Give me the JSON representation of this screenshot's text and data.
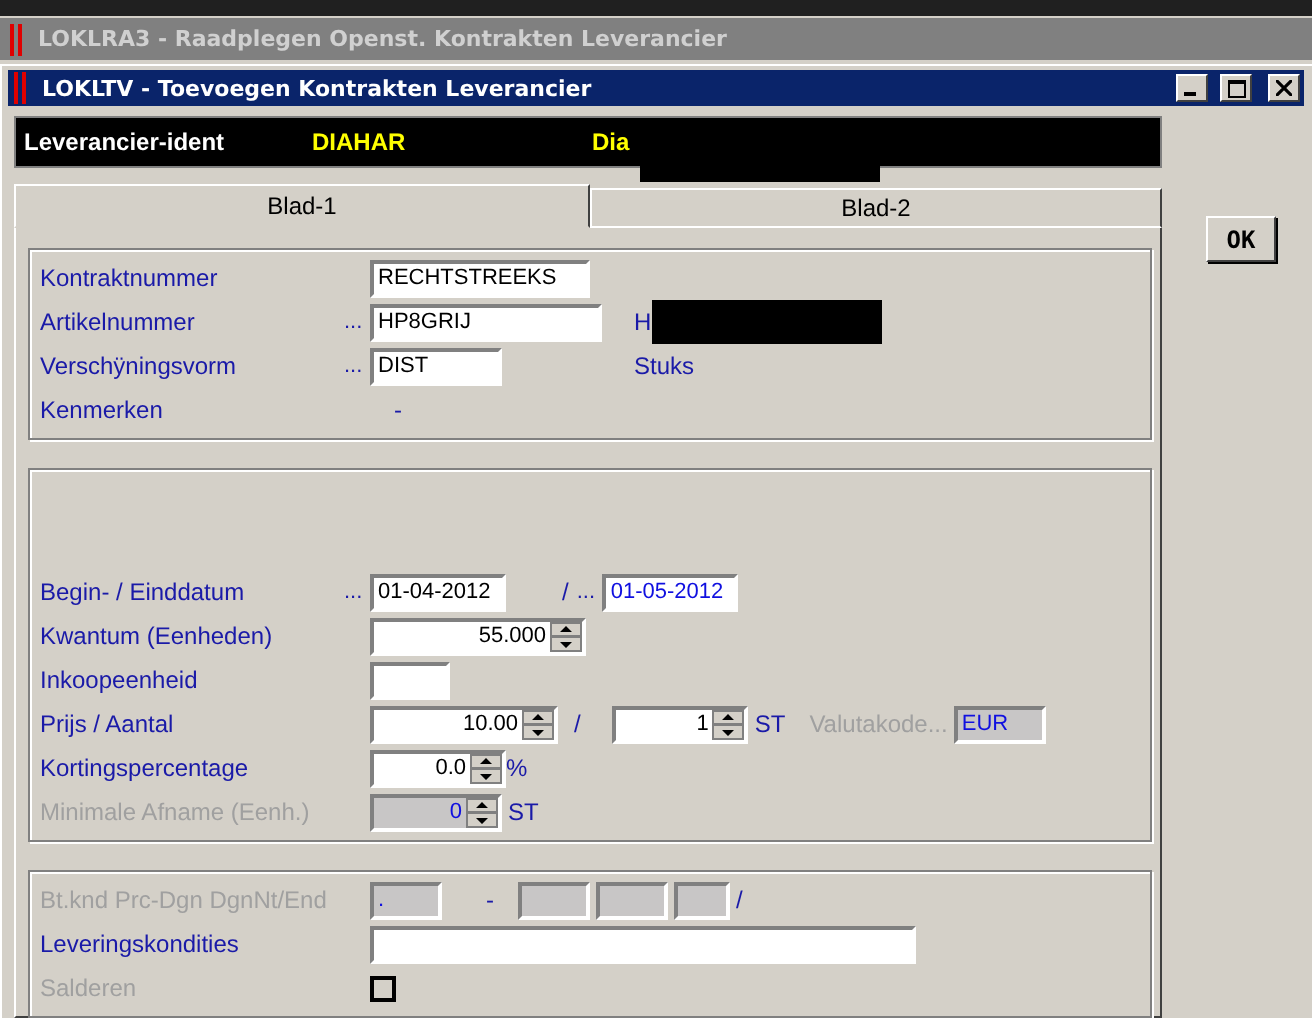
{
  "background_window": {
    "title": "LOKLRA3 - Raadplegen Openst. Kontrakten Leverancier"
  },
  "window": {
    "title": "LOKLTV - Toevoegen Kontrakten Leverancier"
  },
  "header": {
    "label": "Leverancier-ident",
    "code": "DIAHAR",
    "name": "Dia"
  },
  "tabs": [
    {
      "label": "Blad-1",
      "selected": true
    },
    {
      "label": "Blad-2",
      "selected": false
    }
  ],
  "ok_button": "OK",
  "sections": [
    {
      "kind": "plain",
      "rows": [
        {
          "label": "Kontraktnummer",
          "disabled": false,
          "parts": [
            {
              "kind": "input",
              "value": "RECHTSTREEKS"
            }
          ]
        },
        {
          "label": "Artikelnummer",
          "disabled": false,
          "parts": [
            {
              "kind": "dots",
              "text": "..."
            },
            {
              "kind": "input",
              "value": "HP8GRIJ"
            },
            {
              "kind": "text",
              "text": "H",
              "disabled": false
            },
            {
              "kind": "redacted"
            }
          ]
        },
        {
          "label": "Verschÿningsvorm",
          "disabled": false,
          "parts": [
            {
              "kind": "dots",
              "text": "..."
            },
            {
              "kind": "input",
              "value": "DIST"
            },
            {
              "kind": "text",
              "text": "Stuks",
              "disabled": false
            }
          ]
        },
        {
          "label": "Kenmerken",
          "disabled": false,
          "parts": [
            {
              "kind": "text",
              "text": "-",
              "disabled": false
            }
          ]
        }
      ]
    },
    {
      "kind": "spaced",
      "rows": [
        {
          "label": "Begin- / Einddatum",
          "disabled": false,
          "parts": [
            {
              "kind": "dots",
              "text": "..."
            },
            {
              "kind": "input",
              "value": "01-04-2012"
            },
            {
              "kind": "text",
              "text": "/",
              "disabled": false
            },
            {
              "kind": "dots",
              "text": "..."
            },
            {
              "kind": "accent-input",
              "value": "01-05-2012"
            }
          ]
        },
        {
          "label": "Kwantum (Eenheden)",
          "disabled": false,
          "parts": [
            {
              "kind": "spin",
              "value": "55.000"
            }
          ]
        },
        {
          "label": "Inkoopeenheid",
          "disabled": false,
          "parts": [
            {
              "kind": "input"
            }
          ]
        },
        {
          "label": "Prijs / Aantal",
          "disabled": false,
          "parts": [
            {
              "kind": "spin",
              "value": "10.00"
            },
            {
              "kind": "text",
              "text": "/",
              "disabled": false
            },
            {
              "kind": "spin",
              "value": "1"
            },
            {
              "kind": "text",
              "text": "ST",
              "disabled": false
            },
            {
              "kind": "text",
              "text": "Valutakode...",
              "disabled": true
            },
            {
              "kind": "readonly",
              "value": "EUR"
            }
          ]
        },
        {
          "label": "Kortingspercentage",
          "disabled": false,
          "parts": [
            {
              "kind": "spin",
              "value": "0.0"
            },
            {
              "kind": "text",
              "text": "%",
              "disabled": false
            }
          ]
        },
        {
          "label": "Minimale Afname (Eenh.)",
          "disabled": true,
          "parts": [
            {
              "kind": "spin-readonly",
              "value": "0"
            },
            {
              "kind": "text",
              "text": "ST",
              "disabled": false
            }
          ]
        }
      ]
    },
    {
      "kind": "plain",
      "rows": [
        {
          "label": "Bt.knd Prc-Dgn DgnNt/End",
          "disabled": true,
          "parts": [
            {
              "kind": "readonly",
              "value": "."
            },
            {
              "kind": "text",
              "text": "-",
              "disabled": false
            },
            {
              "kind": "readonly"
            },
            {
              "kind": "readonly"
            },
            {
              "kind": "readonly"
            },
            {
              "kind": "text",
              "text": "/",
              "disabled": false
            }
          ]
        },
        {
          "label": "Leveringskondities",
          "disabled": false,
          "parts": [
            {
              "kind": "input"
            }
          ]
        },
        {
          "label": "Salderen",
          "disabled": true,
          "parts": [
            {
              "kind": "checkbox",
              "checked": false
            }
          ]
        }
      ]
    }
  ]
}
